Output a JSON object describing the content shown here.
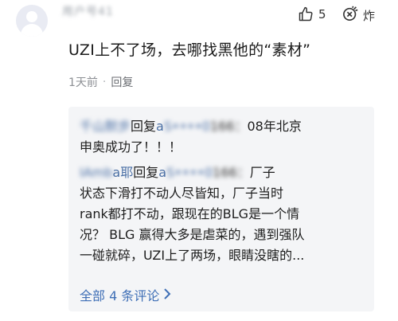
{
  "comment": {
    "username": "用户号41",
    "like_count": "5",
    "bomb_label": "炸",
    "text": "UZI上不了场，去哪找黑他的“素材”",
    "time": "1天前",
    "dot": "·",
    "reply_label": "回复"
  },
  "replies": [
    {
      "author_blurred": "千山默步",
      "reply_word": "回复",
      "target_prefix": "a",
      "target_blurred": "S••••0",
      "target_suffix": "166：",
      "line1_text": "08年北京",
      "line2": "申奥成功了！！！"
    },
    {
      "author_blurred": "IAmb",
      "author_visible_suffix": "a耶",
      "reply_word": "回复",
      "target_prefix": "a",
      "target_blurred": "S••••0",
      "target_suffix": "166：",
      "line1_text": "厂子",
      "line2": "状态下滑打不动人尽皆知，厂子当时",
      "line3": "rank都打不动，跟现在的BLG是一个情",
      "line4": "况？ BLG 赢得大多是虐菜的，遇到强队",
      "line5": "一碰就碎，UZI上了两场，眼睛没瞎的..."
    }
  ],
  "more_label": "全部 4 条评论",
  "colors": {
    "link": "#3f6fb6",
    "name": "#4a6fa5",
    "panel": "#f4f5f7",
    "meta": "#8c8f94"
  },
  "icons": [
    "avatar-placeholder",
    "thumbs-up-icon",
    "bomb-icon",
    "chevron-right-icon"
  ]
}
